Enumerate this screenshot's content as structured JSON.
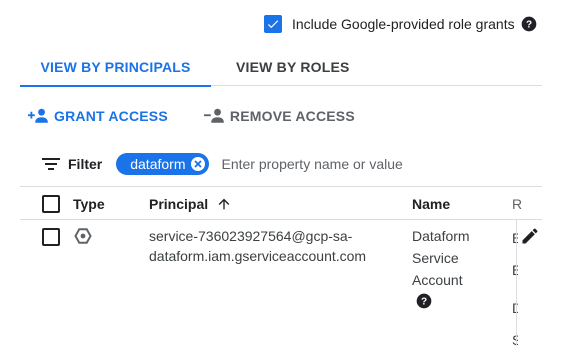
{
  "include_grants": {
    "label": "Include Google-provided role grants",
    "checked": true
  },
  "tabs": [
    {
      "label": "VIEW BY PRINCIPALS",
      "active": true
    },
    {
      "label": "VIEW BY ROLES",
      "active": false
    }
  ],
  "actions": {
    "grant": "GRANT ACCESS",
    "remove": "REMOVE ACCESS"
  },
  "filter": {
    "label": "Filter",
    "chip": "dataform",
    "placeholder": "Enter property name or value"
  },
  "table": {
    "headers": {
      "type": "Type",
      "principal": "Principal",
      "name": "Name",
      "truncated": "R"
    },
    "rows": [
      {
        "principal_line1": "service-736023927564@gcp-sa-",
        "principal_line2": "dataform.iam.gserviceaccount.com",
        "name_line1": "Dataform",
        "name_line2": "Service",
        "name_line3": "Account",
        "truncated_role_letters": [
          "E",
          "E",
          "D",
          "S"
        ]
      }
    ]
  },
  "colors": {
    "accent": "#1a73e8",
    "text": "#202124",
    "muted": "#5f6368",
    "divider": "#dadce0"
  }
}
